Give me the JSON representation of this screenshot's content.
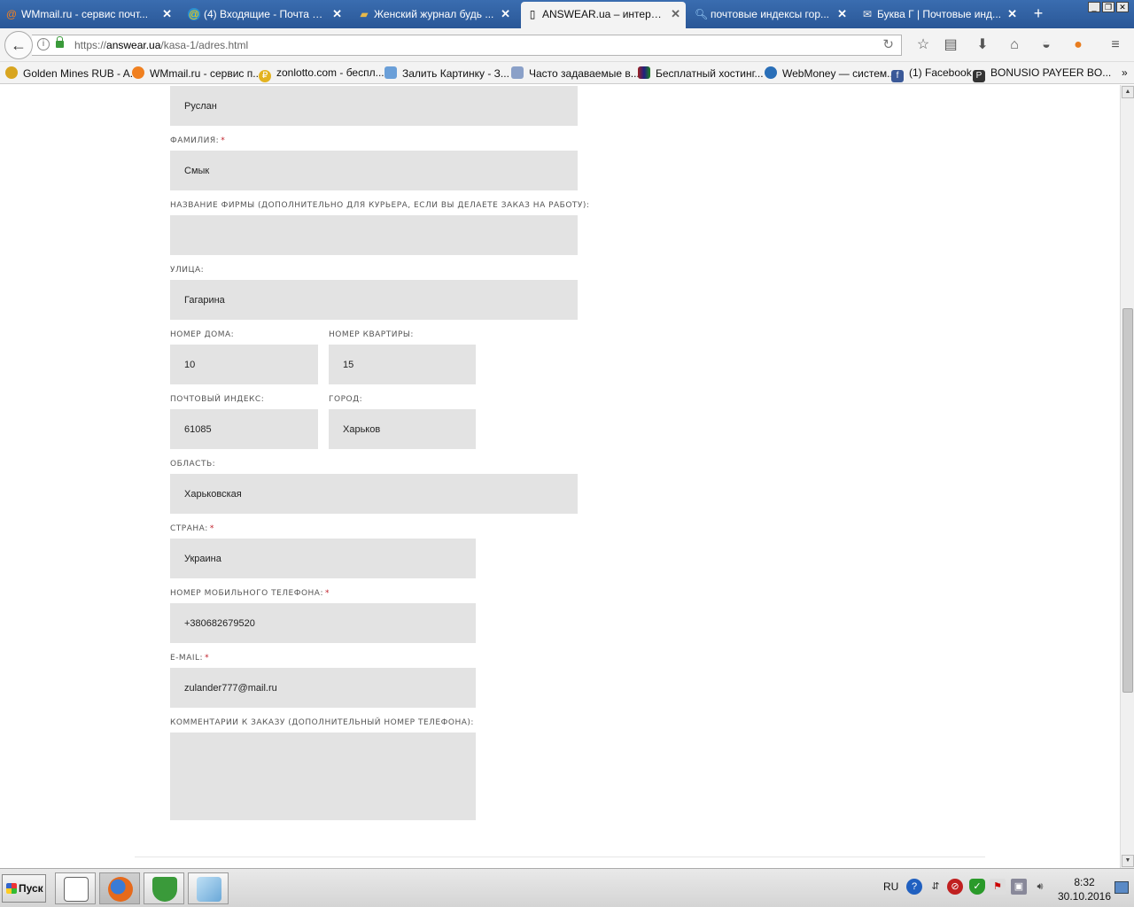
{
  "browser": {
    "tabs": [
      {
        "label": "WMmail.ru - сервис почт...",
        "icon": "at-icon"
      },
      {
        "label": "(4) Входящие - Почта M...",
        "icon": "mail-icon"
      },
      {
        "label": "Женский журнал будь ...",
        "icon": "magazine-icon"
      },
      {
        "label": "ANSWEAR.ua – интерне...",
        "icon": "answear-icon"
      },
      {
        "label": "почтовые индексы гор...",
        "icon": "search-icon"
      },
      {
        "label": "Буква Г | Почтовые инд...",
        "icon": "envelope-icon"
      }
    ],
    "active_tab": 3,
    "url_prefix": "https://",
    "url_domain": "answear.ua",
    "url_path": "/kasa-1/adres.html",
    "bookmarks": [
      "Golden Mines RUB - A...",
      "WMmail.ru - сервис п...",
      "zonlotto.com - беспл...",
      "Залить Картинку - З...",
      "Часто задаваемые в...",
      "Бесплатный хостинг...",
      "WebMoney — систем...",
      "(1) Facebook",
      "BONUSIO PAYEER BO..."
    ],
    "more_bookmarks": "»"
  },
  "form": {
    "first_name": {
      "value": "Руслан"
    },
    "last_name": {
      "label": "Фамилия:",
      "value": "Смык",
      "required": "*"
    },
    "company": {
      "label": "Название фирмы (дополнительно для курьера, если вы делаете заказ на работу):",
      "value": ""
    },
    "street": {
      "label": "Улица:",
      "value": "Гагарина"
    },
    "house": {
      "label": "Номер дома:",
      "value": "10"
    },
    "apartment": {
      "label": "Номер квартиры:",
      "value": "15"
    },
    "postcode": {
      "label": "Почтовый индекс:",
      "value": "61085"
    },
    "city": {
      "label": "Город:",
      "value": "Харьков"
    },
    "region": {
      "label": "Область:",
      "value": "Харьковская"
    },
    "country": {
      "label": "Страна:",
      "value": "Украина",
      "required": "*"
    },
    "phone": {
      "label": "Номер мобильного телефона:",
      "value": "+380682679520",
      "required": "*"
    },
    "email": {
      "label": "E-mail:",
      "value": "zulander777@mail.ru",
      "required": "*"
    },
    "comments": {
      "label": "Комментарии к заказу (дополнительный номер телефона):",
      "value": ""
    }
  },
  "taskbar": {
    "start_label": "Пуск",
    "language": "RU",
    "time": "8:32",
    "date": "30.10.2016"
  }
}
